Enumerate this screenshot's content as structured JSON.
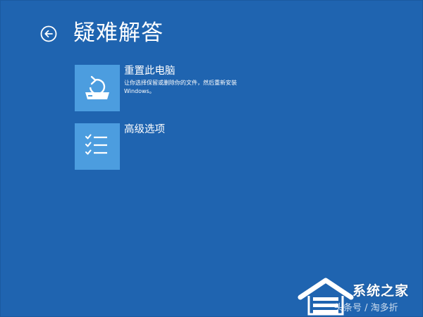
{
  "header": {
    "title": "疑难解答",
    "back_icon": "back-arrow-icon"
  },
  "options": [
    {
      "title": "重置此电脑",
      "description": "让你选择保留或删除你的文件，然后重新安装 Windows。",
      "icon": "reset-pc-icon"
    },
    {
      "title": "高级选项",
      "icon": "checklist-icon"
    }
  ],
  "watermark": {
    "brand": "系统之家",
    "sub": "头条号 / 淘多折"
  },
  "colors": {
    "background": "#1f64b0",
    "tile": "#4c9ddf",
    "text": "#ffffff"
  }
}
